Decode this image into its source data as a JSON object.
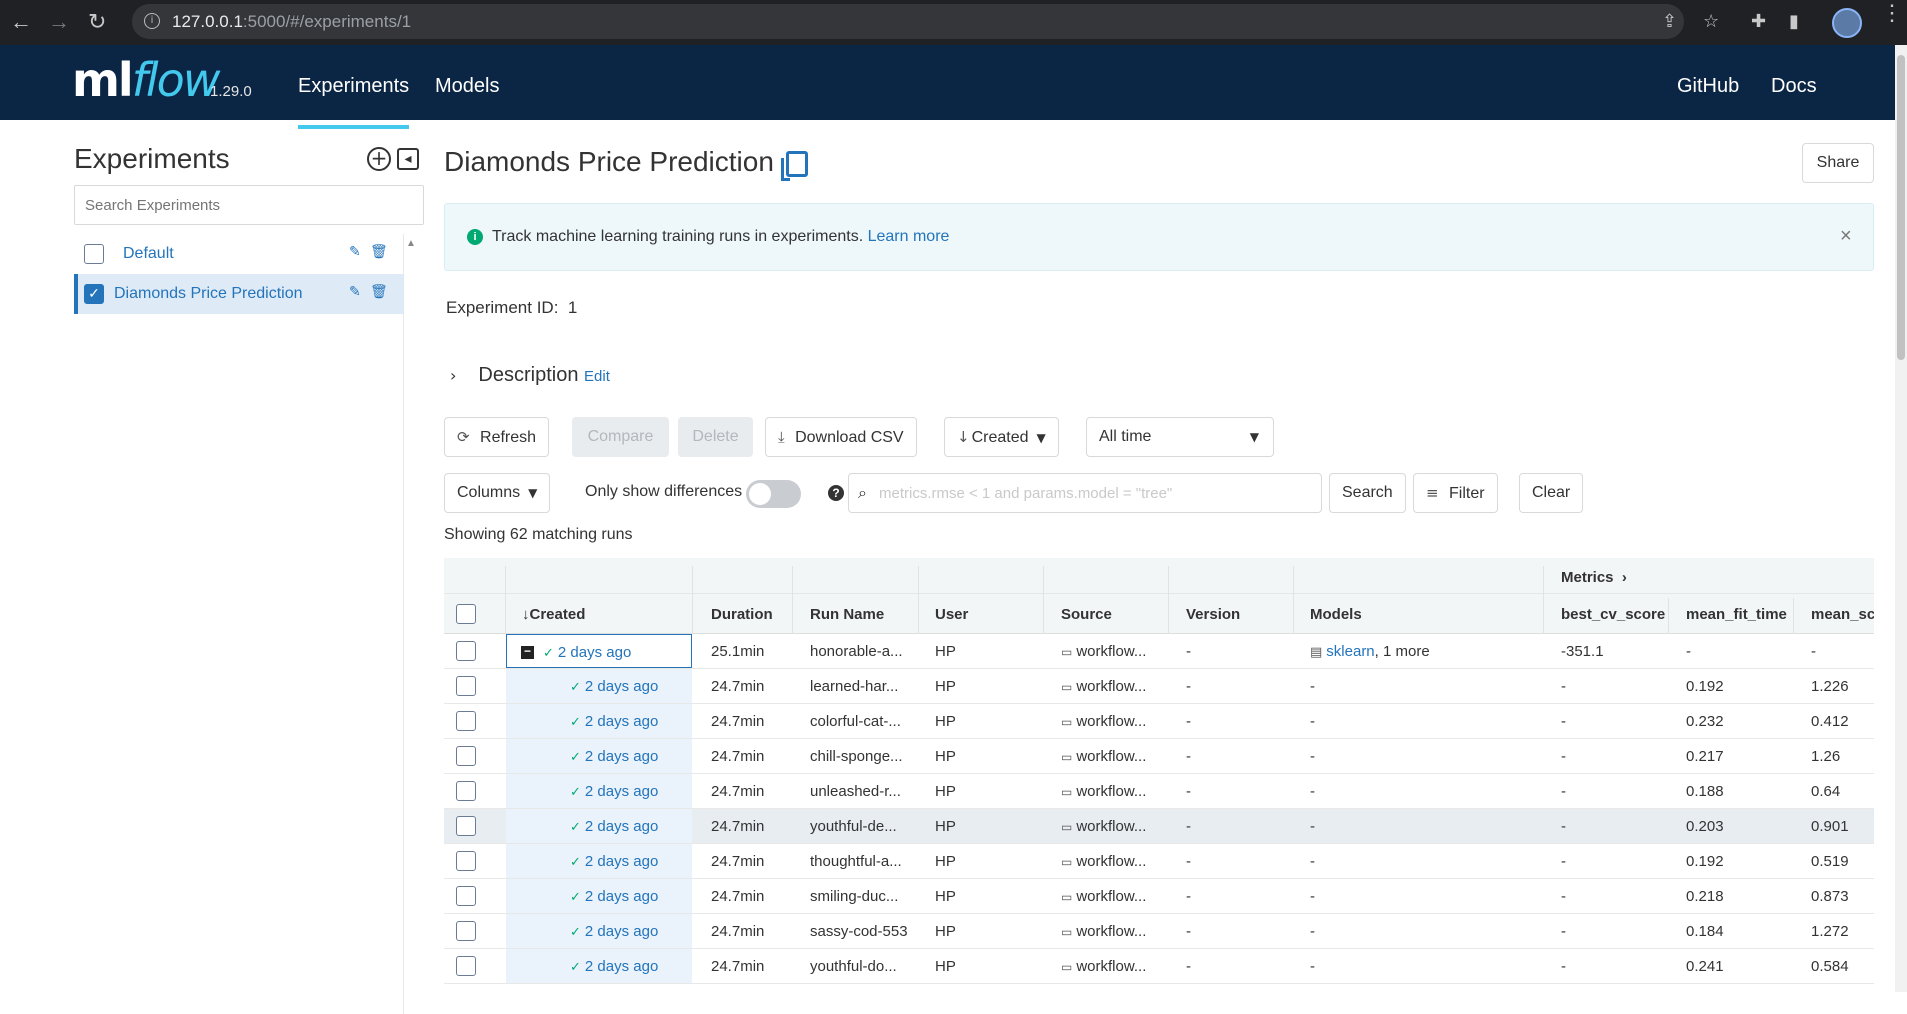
{
  "browser": {
    "url_host": "127.0.0.1",
    "url_rest": ":5000/#/experiments/1"
  },
  "header": {
    "logo_ml": "ml",
    "logo_flow": "flow",
    "version": "1.29.0",
    "nav": [
      "Experiments",
      "Models"
    ],
    "right_nav": [
      "GitHub",
      "Docs"
    ]
  },
  "sidebar": {
    "title": "Experiments",
    "search_placeholder": "Search Experiments",
    "items": [
      {
        "label": "Default",
        "checked": false
      },
      {
        "label": "Diamonds Price Prediction",
        "checked": true
      }
    ]
  },
  "main": {
    "title": "Diamonds Price Prediction",
    "share": "Share",
    "banner_text": "Track machine learning training runs in experiments.",
    "banner_link": "Learn more",
    "experiment_id_label": "Experiment ID:",
    "experiment_id": "1",
    "description": "Description",
    "description_edit": "Edit",
    "toolbar": {
      "refresh": "Refresh",
      "compare": "Compare",
      "delete": "Delete",
      "download": "Download CSV",
      "sort": "Created",
      "time": "All time",
      "columns": "Columns",
      "only_diff": "Only show differences",
      "search_placeholder": "metrics.rmse < 1 and params.model = \"tree\"",
      "search": "Search",
      "filter": "Filter",
      "clear": "Clear"
    },
    "matching": "Showing 62 matching runs"
  },
  "table": {
    "group_header": "Metrics",
    "columns": [
      "Created",
      "Duration",
      "Run Name",
      "User",
      "Source",
      "Version",
      "Models",
      "best_cv_score",
      "mean_fit_time",
      "mean_scc"
    ],
    "rows": [
      {
        "created": "2 days ago",
        "duration": "25.1min",
        "run": "honorable-a...",
        "user": "HP",
        "source": "workflow...",
        "version": "-",
        "model_link": "sklearn",
        "model_more": ", 1 more",
        "best": "-351.1",
        "fit": "-",
        "score": "-"
      },
      {
        "created": "2 days ago",
        "duration": "24.7min",
        "run": "learned-har...",
        "user": "HP",
        "source": "workflow...",
        "version": "-",
        "model_text": "-",
        "best": "-",
        "fit": "0.192",
        "score": "1.226"
      },
      {
        "created": "2 days ago",
        "duration": "24.7min",
        "run": "colorful-cat-...",
        "user": "HP",
        "source": "workflow...",
        "version": "-",
        "model_text": "-",
        "best": "-",
        "fit": "0.232",
        "score": "0.412"
      },
      {
        "created": "2 days ago",
        "duration": "24.7min",
        "run": "chill-sponge...",
        "user": "HP",
        "source": "workflow...",
        "version": "-",
        "model_text": "-",
        "best": "-",
        "fit": "0.217",
        "score": "1.26"
      },
      {
        "created": "2 days ago",
        "duration": "24.7min",
        "run": "unleashed-r...",
        "user": "HP",
        "source": "workflow...",
        "version": "-",
        "model_text": "-",
        "best": "-",
        "fit": "0.188",
        "score": "0.64"
      },
      {
        "created": "2 days ago",
        "duration": "24.7min",
        "run": "youthful-de...",
        "user": "HP",
        "source": "workflow...",
        "version": "-",
        "model_text": "-",
        "best": "-",
        "fit": "0.203",
        "score": "0.901"
      },
      {
        "created": "2 days ago",
        "duration": "24.7min",
        "run": "thoughtful-a...",
        "user": "HP",
        "source": "workflow...",
        "version": "-",
        "model_text": "-",
        "best": "-",
        "fit": "0.192",
        "score": "0.519"
      },
      {
        "created": "2 days ago",
        "duration": "24.7min",
        "run": "smiling-duc...",
        "user": "HP",
        "source": "workflow...",
        "version": "-",
        "model_text": "-",
        "best": "-",
        "fit": "0.218",
        "score": "0.873"
      },
      {
        "created": "2 days ago",
        "duration": "24.7min",
        "run": "sassy-cod-553",
        "user": "HP",
        "source": "workflow...",
        "version": "-",
        "model_text": "-",
        "best": "-",
        "fit": "0.184",
        "score": "1.272"
      },
      {
        "created": "2 days ago",
        "duration": "24.7min",
        "run": "youthful-do...",
        "user": "HP",
        "source": "workflow...",
        "version": "-",
        "model_text": "-",
        "best": "-",
        "fit": "0.241",
        "score": "0.584"
      }
    ]
  },
  "colors": {
    "header_bg": "#0b2544",
    "accent": "#43c9ed",
    "link": "#2374bb",
    "success": "#00a972"
  }
}
